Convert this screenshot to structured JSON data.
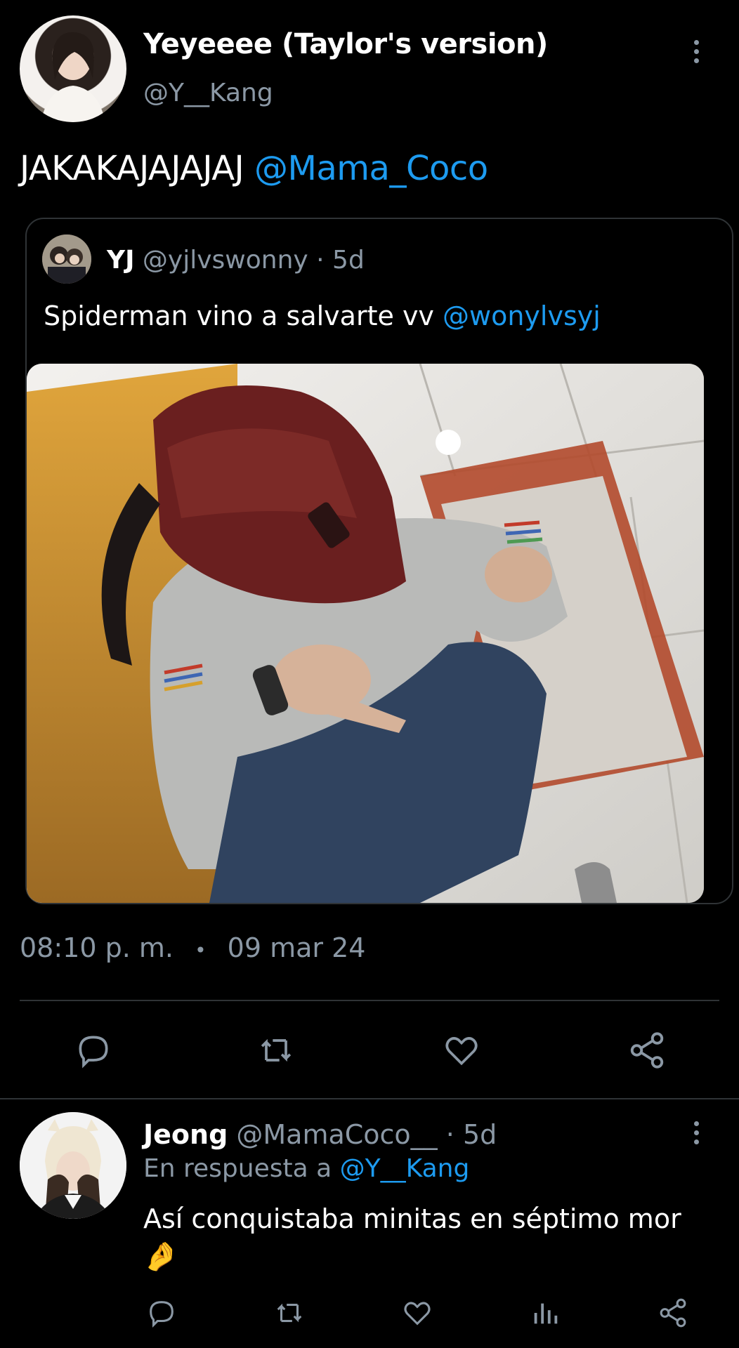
{
  "tweet": {
    "author_name": "Yeyeeee (Taylor's version)",
    "author_handle": "@Y__Kang",
    "text": "JAKAKAJAJAJAJ",
    "mention": "@Mama_Coco",
    "time": "08:10 p. m.",
    "separator": "•",
    "date": "09 mar 24",
    "avatar_icon": "profile-photo"
  },
  "quoted": {
    "author_name": "YJ",
    "author_handle": "@yjlvswonny",
    "age": "· 5d",
    "text": "Spiderman vino a salvarte vv",
    "mention": "@wonylvsyj",
    "media_icon": "photo-person-with-backpack-on-head"
  },
  "actions": [
    "reply-icon",
    "retweet-icon",
    "like-icon",
    "share-icon"
  ],
  "reply": {
    "author_name": "Jeong",
    "author_handle": "@MamaCoco__",
    "age": "· 5d",
    "in_reply_prefix": "En respuesta a",
    "in_reply_handle": "@Y__Kang",
    "text": "Así conquistaba minitas en séptimo mor",
    "emoji": "🤌",
    "actions": [
      "reply-icon",
      "retweet-icon",
      "like-icon",
      "views-icon",
      "share-icon"
    ]
  },
  "colors": {
    "background": "#000000",
    "text": "#e7e9ea",
    "muted": "#8b98a5",
    "link": "#1d9bf0",
    "divider": "#2f3336"
  }
}
